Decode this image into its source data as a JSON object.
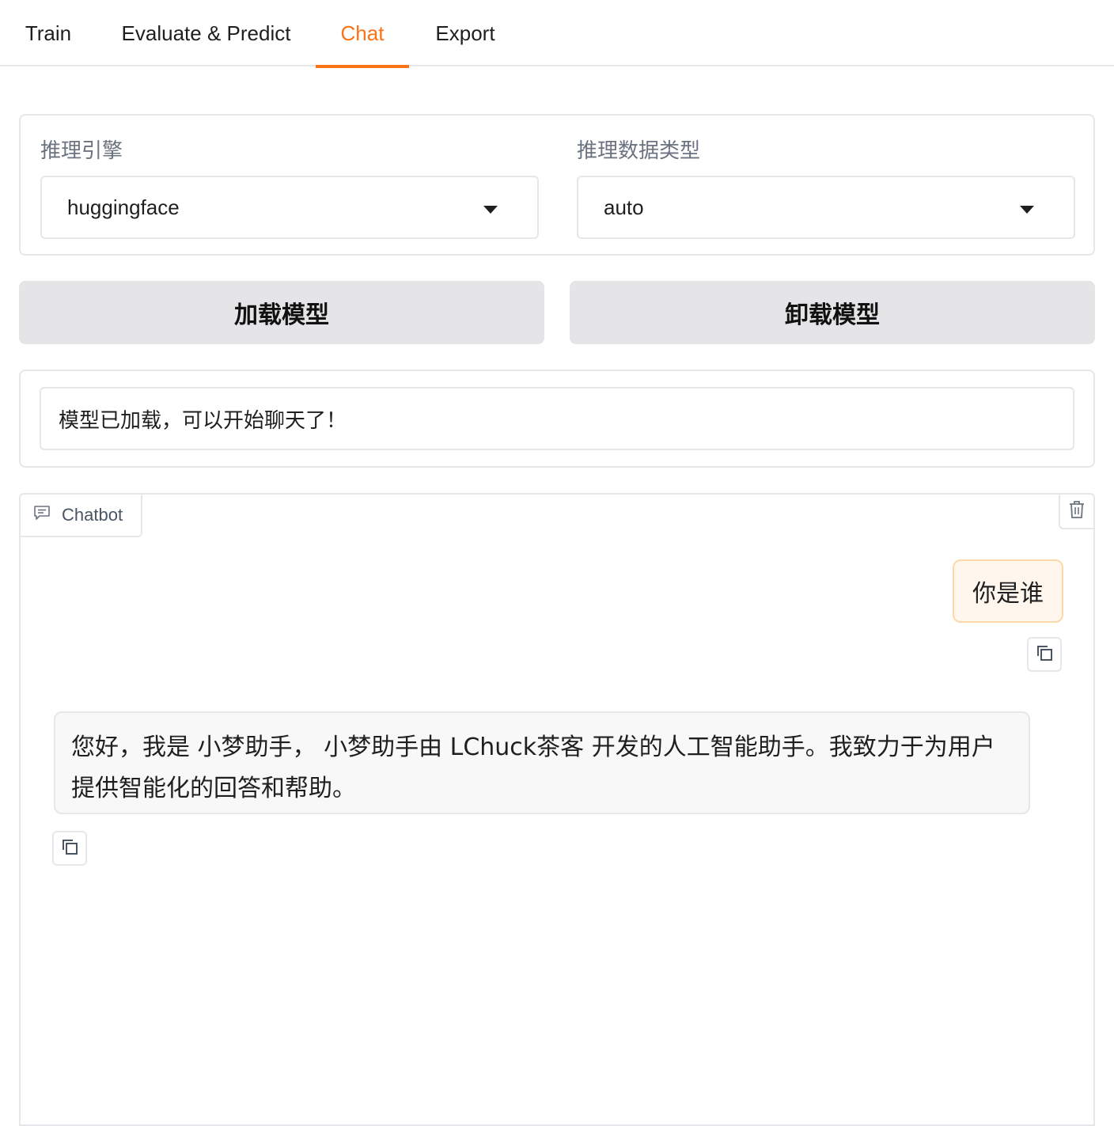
{
  "tabs": [
    {
      "label": "Train"
    },
    {
      "label": "Evaluate & Predict"
    },
    {
      "label": "Chat"
    },
    {
      "label": "Export"
    }
  ],
  "active_tab": "Chat",
  "accent_color": "#f97316",
  "config": {
    "engine_label": "推理引擎",
    "engine_value": "huggingface",
    "dtype_label": "推理数据类型",
    "dtype_value": "auto"
  },
  "buttons": {
    "load": "加载模型",
    "unload": "卸载模型"
  },
  "status": {
    "text": "模型已加载，可以开始聊天了！"
  },
  "chatbot": {
    "label": "Chatbot",
    "messages": [
      {
        "role": "user",
        "text": "你是谁"
      },
      {
        "role": "assistant",
        "text": "您好，我是 小梦助手， 小梦助手由 LChuck茶客 开发的人工智能助手。我致力于为用户提供智能化的回答和帮助。"
      }
    ]
  }
}
